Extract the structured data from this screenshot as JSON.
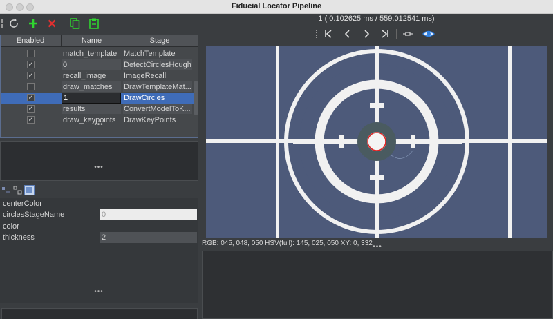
{
  "window": {
    "title": "Fiducial Locator Pipeline"
  },
  "toolbar": {
    "buttons": [
      "refresh-icon",
      "add-icon",
      "remove-icon",
      "copy-icon",
      "paste-icon"
    ]
  },
  "table": {
    "columns": [
      "Enabled",
      "Name",
      "Stage"
    ],
    "rows": [
      {
        "enabled": false,
        "name": "match_template",
        "stage": "MatchTemplate"
      },
      {
        "enabled": true,
        "name": "0",
        "stage": "DetectCirclesHough"
      },
      {
        "enabled": true,
        "name": "recall_image",
        "stage": "ImageRecall"
      },
      {
        "enabled": false,
        "name": "draw_matches",
        "stage": "DrawTemplateMat..."
      },
      {
        "enabled": true,
        "name": "1",
        "stage": "DrawCircles"
      },
      {
        "enabled": true,
        "name": "results",
        "stage": "ConvertModelToK..."
      },
      {
        "enabled": true,
        "name": "draw_keypoints",
        "stage": "DrawKeyPoints"
      }
    ]
  },
  "properties": [
    {
      "label": "centerColor",
      "value": ""
    },
    {
      "label": "circlesStageName",
      "value": "0"
    },
    {
      "label": "color",
      "value": ""
    },
    {
      "label": "thickness",
      "value": "2"
    }
  ],
  "viewer": {
    "timing": "1 ( 0.102625 ms / 559.012541 ms)",
    "status": "RGB: 045, 048, 050 HSV(full): 145, 025, 050 XY: 0, 332",
    "nav": [
      "first-icon",
      "prev-icon",
      "next-icon",
      "last-icon",
      "pin-icon",
      "eye-icon"
    ]
  },
  "colors": {
    "selection": "#3f6cb8",
    "add": "#2fd62f",
    "remove": "#e03030",
    "accent": "#2e7fe0"
  }
}
